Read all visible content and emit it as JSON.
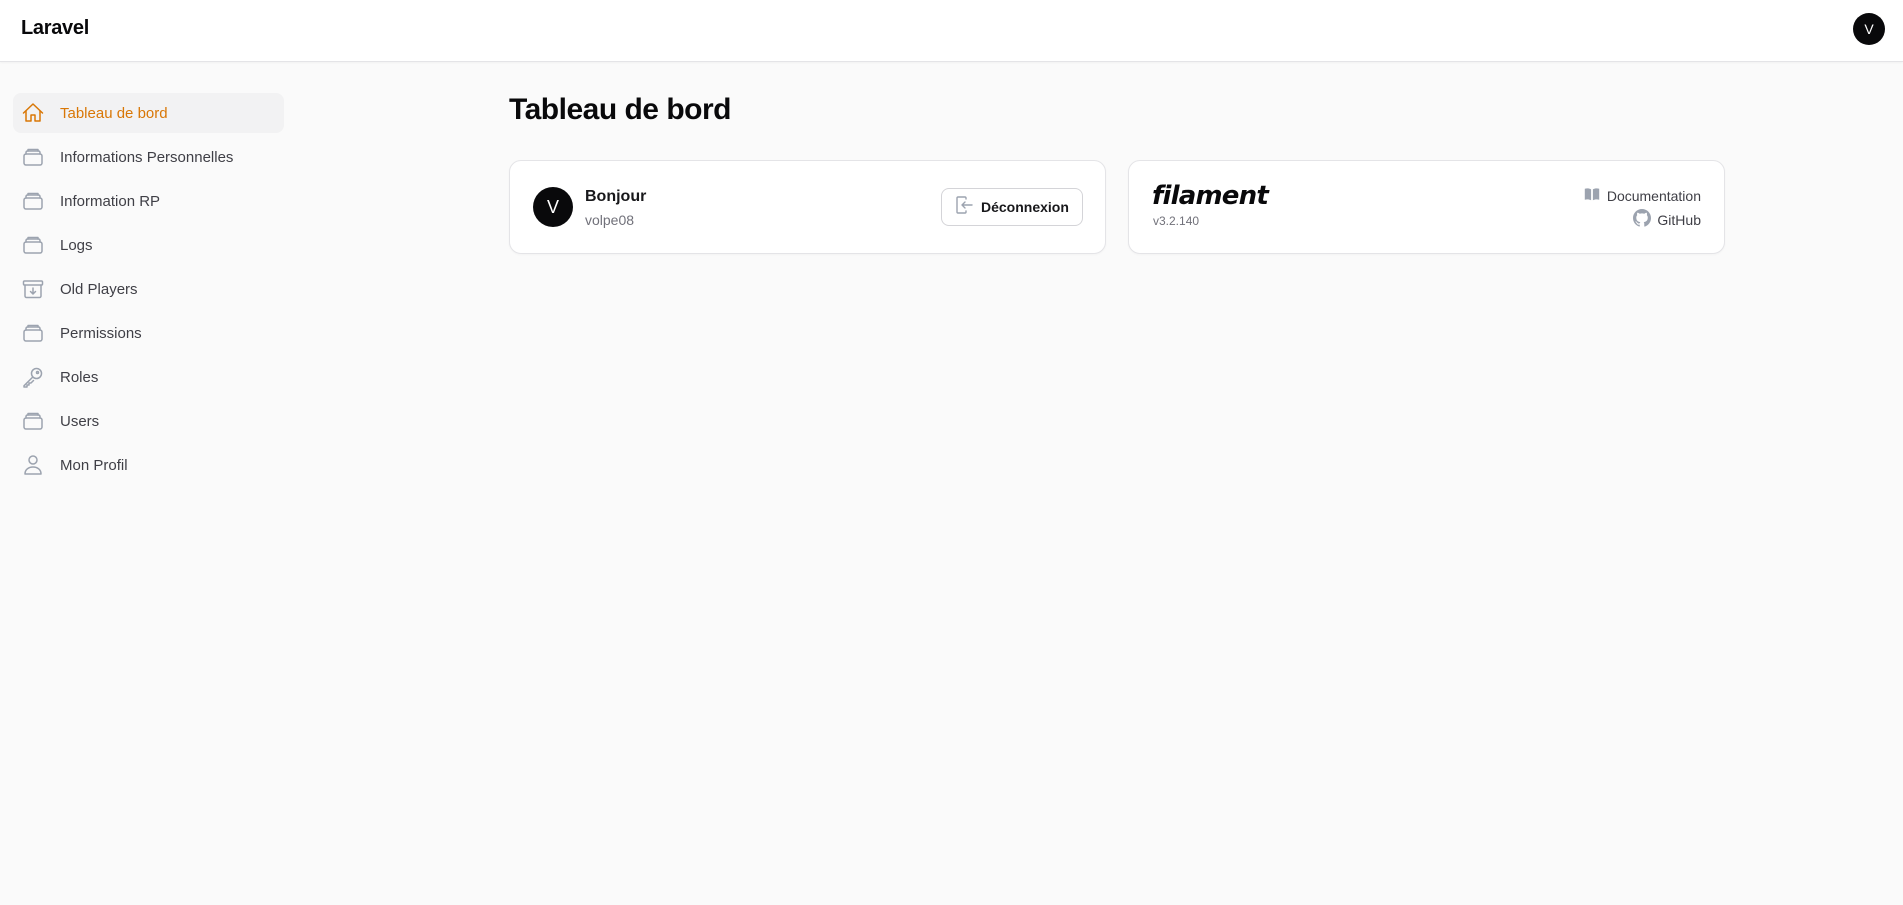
{
  "topbar": {
    "brand": "Laravel",
    "user_initial": "V"
  },
  "sidebar": {
    "items": [
      {
        "label": "Tableau de bord",
        "icon": "home-icon",
        "active": true
      },
      {
        "label": "Informations Personnelles",
        "icon": "stack-icon",
        "active": false
      },
      {
        "label": "Information RP",
        "icon": "stack-icon",
        "active": false
      },
      {
        "label": "Logs",
        "icon": "stack-icon",
        "active": false
      },
      {
        "label": "Old Players",
        "icon": "archive-icon",
        "active": false
      },
      {
        "label": "Permissions",
        "icon": "stack-icon",
        "active": false
      },
      {
        "label": "Roles",
        "icon": "key-icon",
        "active": false
      },
      {
        "label": "Users",
        "icon": "stack-icon",
        "active": false
      },
      {
        "label": "Mon Profil",
        "icon": "user-icon",
        "active": false
      }
    ]
  },
  "main": {
    "title": "Tableau de bord",
    "user_card": {
      "avatar_initial": "V",
      "greeting": "Bonjour",
      "username": "volpe08",
      "logout_label": "Déconnexion"
    },
    "filament_card": {
      "logo_text": "filament",
      "version": "v3.2.140",
      "documentation_label": "Documentation",
      "github_label": "GitHub"
    }
  },
  "colors": {
    "accent": "#d97706",
    "background": "#fafafa",
    "avatar": "#09090b"
  }
}
